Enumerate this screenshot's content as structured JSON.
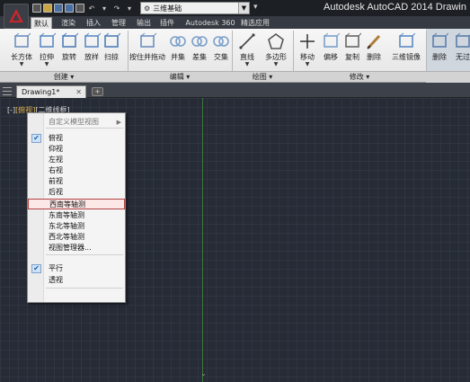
{
  "title_bar": {
    "app_title": "Autodesk AutoCAD 2014    Drawin",
    "workspace_name": "三维基础"
  },
  "ribbon_tabs": [
    "默认",
    "渲染",
    "插入",
    "管理",
    "输出",
    "插件",
    "Autodesk 360",
    "精选应用"
  ],
  "ribbon_tools": [
    {
      "label": "长方体",
      "sub": "▼",
      "icon": "box-icon"
    },
    {
      "label": "拉伸",
      "sub": "▼",
      "icon": "extrude-icon"
    },
    {
      "label": "旋转",
      "sub": "",
      "icon": "revolve-icon"
    },
    {
      "label": "放样",
      "sub": "",
      "icon": "loft-icon"
    },
    {
      "label": "扫掠",
      "sub": "",
      "icon": "sweep-icon"
    },
    {
      "label": "按住并拖动",
      "sub": "",
      "icon": "presspull-icon"
    },
    {
      "label": "并集",
      "sub": "",
      "icon": "union-icon"
    },
    {
      "label": "差集",
      "sub": "",
      "icon": "subtract-icon"
    },
    {
      "label": "交集",
      "sub": "",
      "icon": "intersect-icon"
    },
    {
      "label": "直线",
      "sub": "▼",
      "icon": "line-icon"
    },
    {
      "label": "多边形",
      "sub": "▼",
      "icon": "polygon-icon"
    },
    {
      "label": "移动",
      "sub": "▼",
      "icon": "move-icon"
    },
    {
      "label": "偏移",
      "sub": "",
      "icon": "offset-icon"
    },
    {
      "label": "复制",
      "sub": "",
      "icon": "copy-icon"
    },
    {
      "label": "删除",
      "sub": "",
      "icon": "erase-icon"
    },
    {
      "label": "三维镜像",
      "sub": "",
      "icon": "mirror3d-icon"
    },
    {
      "label": "删除",
      "sub": "",
      "icon": "delete-icon"
    },
    {
      "label": "无过",
      "sub": "",
      "icon": "nofilter-icon"
    }
  ],
  "ribbon_groups": [
    {
      "label": "创建 ▾"
    },
    {
      "label": "编辑 ▾"
    },
    {
      "label": "绘图 ▾"
    },
    {
      "label": "修改 ▾"
    }
  ],
  "document": {
    "tab_name": "Drawing1*"
  },
  "viewport": {
    "controls_label": "[-]",
    "view_label": "[俯视]",
    "style_label": "[二维线框]"
  },
  "context_menu": {
    "items": [
      {
        "label": "自定义模型视图",
        "checked": false,
        "submenu": true,
        "disabled": true
      },
      {
        "label": "俯视",
        "checked": true
      },
      {
        "label": "仰视",
        "checked": false
      },
      {
        "label": "左视",
        "checked": false
      },
      {
        "label": "右视",
        "checked": false
      },
      {
        "label": "前视",
        "checked": false
      },
      {
        "label": "后视",
        "checked": false
      },
      {
        "label": "西南等轴测",
        "checked": false,
        "highlighted": true
      },
      {
        "label": "东南等轴测",
        "checked": false
      },
      {
        "label": "东北等轴测",
        "checked": false
      },
      {
        "label": "西北等轴测",
        "checked": false
      },
      {
        "label": "视图管理器...",
        "checked": false
      },
      {
        "label": "平行",
        "checked": true
      },
      {
        "label": "透视",
        "checked": false
      }
    ]
  },
  "colors": {
    "canvas_bg": "#262b35",
    "y_axis": "#3b7a3b",
    "highlight_border": "#b04040",
    "view_label": "#e0b24a"
  }
}
